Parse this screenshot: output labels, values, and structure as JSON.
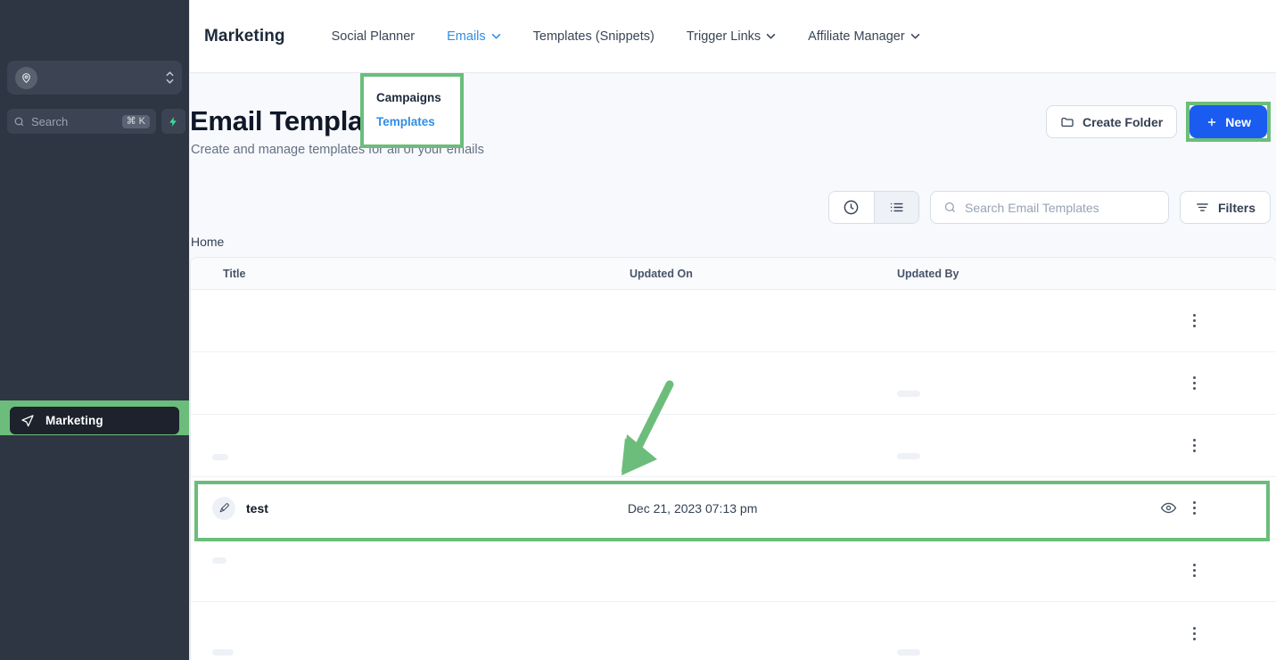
{
  "colors": {
    "highlight_green": "#6cbd7b",
    "primary_blue": "#1a5bf0",
    "link_blue": "#2f8de4",
    "sidebar_bg": "#2e3643",
    "content_bg": "#f7f9fc"
  },
  "sidebar": {
    "account_switcher": {
      "icon": "location-pin-icon",
      "value": ""
    },
    "search": {
      "placeholder": "Search",
      "shortcut": "⌘ K",
      "icon": "search-icon"
    },
    "quick_action": {
      "icon": "lightning-bolt-icon"
    },
    "nav_items": [
      {
        "label": "Marketing",
        "icon": "paper-plane-icon",
        "active": true,
        "highlighted": true
      }
    ]
  },
  "topnav": {
    "brand": "Marketing",
    "items": [
      {
        "label": "Social Planner",
        "has_chevron": false,
        "active": false
      },
      {
        "label": "Emails",
        "has_chevron": true,
        "active": true
      },
      {
        "label": "Templates (Snippets)",
        "has_chevron": false,
        "active": false
      },
      {
        "label": "Trigger Links",
        "has_chevron": true,
        "active": false
      },
      {
        "label": "Affiliate Manager",
        "has_chevron": true,
        "active": false
      }
    ]
  },
  "dropdown": {
    "open": true,
    "highlighted": true,
    "items": [
      {
        "label": "Campaigns",
        "active": false
      },
      {
        "label": "Templates",
        "active": true
      }
    ]
  },
  "page": {
    "title": "Email Templates",
    "subtitle": "Create and manage templates for all of your emails",
    "create_folder_label": "Create Folder",
    "create_folder_icon": "folder-icon",
    "new_label": "New",
    "new_icon": "plus-icon",
    "new_highlighted": true
  },
  "toolbar": {
    "view_toggle": [
      {
        "icon": "clock-icon",
        "selected": false
      },
      {
        "icon": "list-icon",
        "selected": true
      }
    ],
    "search_placeholder": "Search Email Templates",
    "search_icon": "search-icon",
    "search_value": "",
    "filters_label": "Filters",
    "filters_icon": "filter-icon"
  },
  "breadcrumb": "Home",
  "table": {
    "columns": [
      "Title",
      "Updated On",
      "Updated By"
    ],
    "rows": [
      {
        "title": "",
        "updated_on": "",
        "updated_by": "",
        "icon": "",
        "has_preview": false,
        "highlighted": false,
        "skeleton": false
      },
      {
        "title": "",
        "updated_on": "",
        "updated_by": "",
        "icon": "",
        "has_preview": false,
        "highlighted": false,
        "skeleton": true
      },
      {
        "title": "",
        "updated_on": "",
        "updated_by": "",
        "icon": "",
        "has_preview": false,
        "highlighted": false,
        "skeleton": true
      },
      {
        "title": "test",
        "updated_on": "Dec 21, 2023 07:13 pm",
        "updated_by": "",
        "icon": "paintbrush-icon",
        "has_preview": true,
        "highlighted": true,
        "skeleton": false
      },
      {
        "title": "",
        "updated_on": "",
        "updated_by": "",
        "icon": "",
        "has_preview": false,
        "highlighted": false,
        "skeleton": true
      },
      {
        "title": "",
        "updated_on": "",
        "updated_by": "",
        "icon": "",
        "has_preview": false,
        "highlighted": false,
        "skeleton": true
      }
    ],
    "row_action_icons": {
      "preview": "eye-icon",
      "menu": "kebab-menu-icon"
    }
  },
  "annotations": {
    "arrow": {
      "name": "green-arrow-annotation",
      "points_to": "test-row"
    }
  }
}
